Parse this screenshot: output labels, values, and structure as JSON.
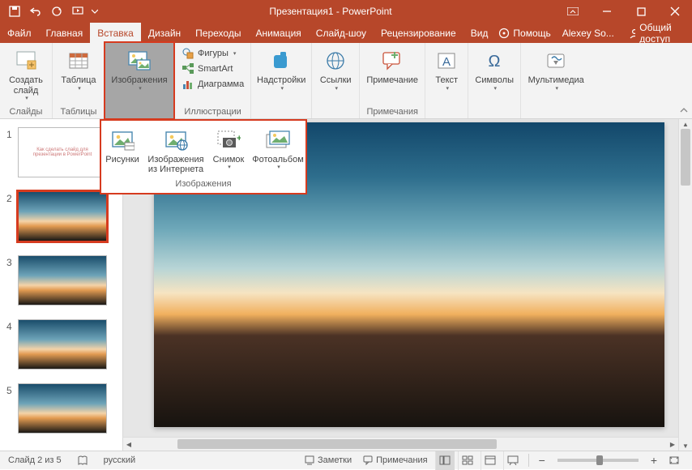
{
  "titlebar": {
    "app_title": "Презентация1 - PowerPoint"
  },
  "tabs": {
    "file": "Файл",
    "home": "Главная",
    "insert": "Вставка",
    "design": "Дизайн",
    "transitions": "Переходы",
    "animations": "Анимация",
    "slideshow": "Слайд-шоу",
    "review": "Рецензирование",
    "view": "Вид",
    "help": "Помощь",
    "user": "Alexey So...",
    "share": "Общий доступ"
  },
  "ribbon": {
    "groups": {
      "slides": {
        "label": "Слайды",
        "new_slide": "Создать\nслайд"
      },
      "tables": {
        "label": "Таблицы",
        "table": "Таблица"
      },
      "images": {
        "label": "Изображения",
        "images_btn": "Изображения"
      },
      "illustrations": {
        "label": "Иллюстрации",
        "shapes": "Фигуры",
        "smartart": "SmartArt",
        "chart": "Диаграмма"
      },
      "addins": {
        "addins_btn": "Надстройки"
      },
      "links": {
        "links_btn": "Ссылки"
      },
      "comments": {
        "label": "Примечания",
        "comment": "Примечание"
      },
      "text": {
        "text_btn": "Текст"
      },
      "symbols": {
        "symbols_btn": "Символы"
      },
      "media": {
        "media_btn": "Мультимедиа"
      }
    }
  },
  "dropdown": {
    "pictures": "Рисунки",
    "online": "Изображения\nиз Интернета",
    "screenshot": "Снимок",
    "album": "Фотоальбом",
    "group_label": "Изображения"
  },
  "thumbs": {
    "items": [
      {
        "num": "1",
        "title": "Как сделать слайд для\nпрезентации в PowerPoint"
      },
      {
        "num": "2"
      },
      {
        "num": "3"
      },
      {
        "num": "4"
      },
      {
        "num": "5"
      }
    ]
  },
  "statusbar": {
    "slide_pos": "Слайд 2 из 5",
    "lang": "русский",
    "notes": "Заметки",
    "comments": "Примечания",
    "zoom_minus": "−",
    "zoom_plus": "+"
  }
}
